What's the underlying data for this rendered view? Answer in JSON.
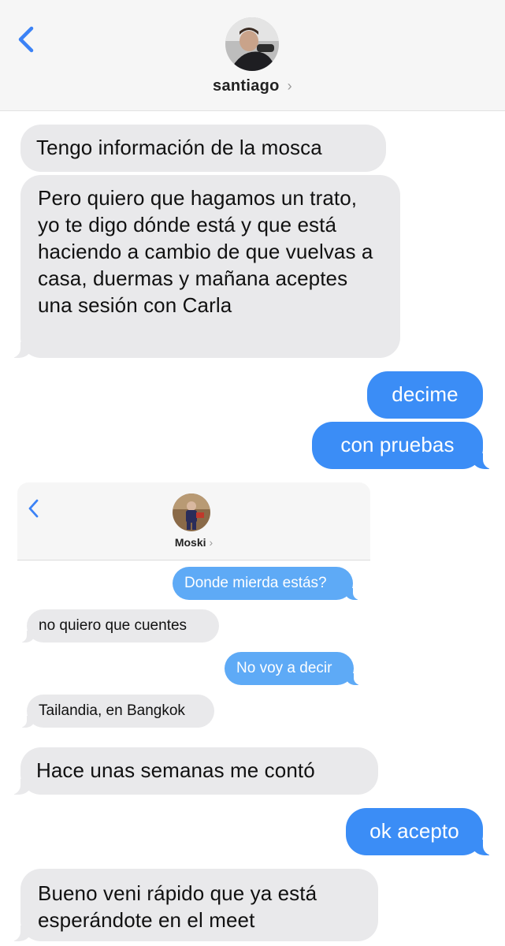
{
  "header": {
    "contact_name": "santiago",
    "chevron": "›",
    "back_icon": "chevron-left-icon",
    "accent": "#3b82f6"
  },
  "messages": [
    {
      "side": "in",
      "text": "Tengo información de la mosca"
    },
    {
      "side": "in",
      "text": "Pero quiero que hagamos un trato, yo te digo dónde está y que está haciendo a cambio de que vuelvas a casa, duermas y mañana aceptes una sesión con Carla"
    },
    {
      "side": "out",
      "text": "decime"
    },
    {
      "side": "out",
      "text": "con pruebas"
    },
    {
      "side": "in",
      "text": "Hace unas semanas me contó"
    },
    {
      "side": "out",
      "text": "ok acepto"
    },
    {
      "side": "in",
      "text": "Bueno veni rápido que ya está esperándote en el meet"
    }
  ],
  "embedded_screenshot": {
    "contact_name": "Moski",
    "chevron": "›",
    "messages": [
      {
        "side": "out",
        "text": "Donde mierda estás?"
      },
      {
        "side": "in",
        "text": "no quiero que cuentes"
      },
      {
        "side": "out",
        "text": "No voy a decir"
      },
      {
        "side": "in",
        "text": "Tailandia, en Bangkok"
      }
    ]
  },
  "colors": {
    "bubble_out": "#3b8df6",
    "bubble_out_light": "#5eaaf6",
    "bubble_in": "#e9e9eb",
    "header_bg": "#f6f6f6"
  }
}
